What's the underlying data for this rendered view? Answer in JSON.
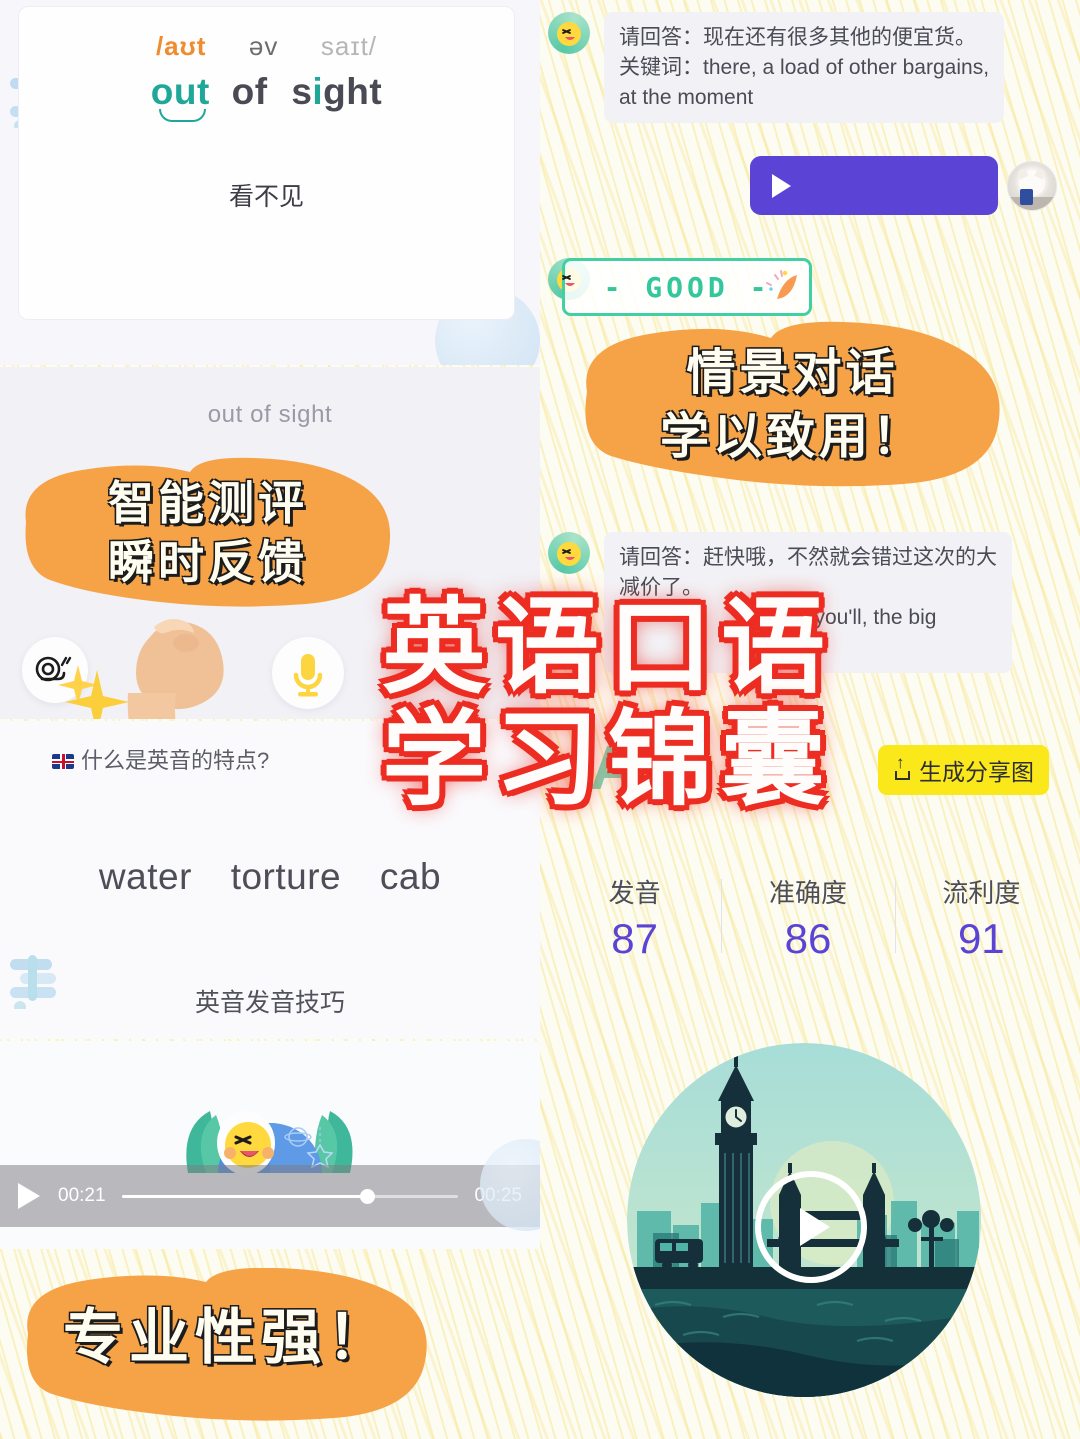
{
  "poster": {
    "main_title_line1": "英语口语",
    "main_title_line2": "学习锦囊",
    "accent_red": "#ed2d23",
    "accent_orange": "#f6a348",
    "accent_purple": "#5b43d6",
    "accent_teal": "#1fa89a",
    "accent_yellow": "#fbe81a"
  },
  "word_card": {
    "phonetic_1": "/aʊt",
    "phonetic_2": "əv",
    "phonetic_3": "saɪt/",
    "word_part_1": "out",
    "word_part_2": "of",
    "word_part_3": "sight",
    "meaning": "看不见"
  },
  "eval_panel": {
    "word": "out of sight",
    "banner_line1": "智能测评",
    "banner_line2": "瞬时反馈",
    "snail_icon": "snail-icon",
    "mic_icon": "microphone-icon",
    "muscle_icon": "flexed-biceps-emoji",
    "sparkle_icon": "sparkle-icon"
  },
  "practice_panel": {
    "question": "什么是英音的特点?",
    "flag_icon": "uk-flag-icon",
    "words": [
      "water",
      "torture",
      "cab"
    ],
    "tip": "英音发音技巧"
  },
  "video_player": {
    "current_time": "00:21",
    "total_time": "00:25",
    "progress_percent": 73,
    "play_icon": "play-icon"
  },
  "chat": {
    "messages": [
      {
        "type": "text",
        "avatar": "mascot-avatar",
        "line1": "请回答：现在还有很多其他的便宜货。",
        "line2": "关键词：there, a load of other bargains,",
        "line3": "at the moment"
      },
      {
        "type": "audio",
        "avatar": "dog-avatar",
        "play_icon": "play-icon"
      },
      {
        "type": "badge",
        "avatar": "mascot-avatar",
        "label": "- GOOD -",
        "confetti_icon": "party-popper-icon"
      },
      {
        "type": "text",
        "avatar": "mascot-avatar",
        "line1": "请回答：赶快哦，不然就会错过这次的大",
        "line2": "减价了。",
        "line3": "r, you'll, the big",
        "line4": "e"
      }
    ],
    "banner_line1": "情景对话",
    "banner_line2": "学以致用！"
  },
  "scores": {
    "share_button": "生成分享图",
    "share_icon": "share-upload-icon",
    "items": [
      {
        "label": "发音",
        "value": "87"
      },
      {
        "label": "准确度",
        "value": "86"
      },
      {
        "label": "流利度",
        "value": "91"
      }
    ],
    "deco_letter_a": "A",
    "deco_letter_e": "e"
  },
  "london_card": {
    "illustration": "london-skyline-illustration",
    "play_icon": "play-icon"
  },
  "bottom_banner": {
    "text": "专业性强！"
  }
}
